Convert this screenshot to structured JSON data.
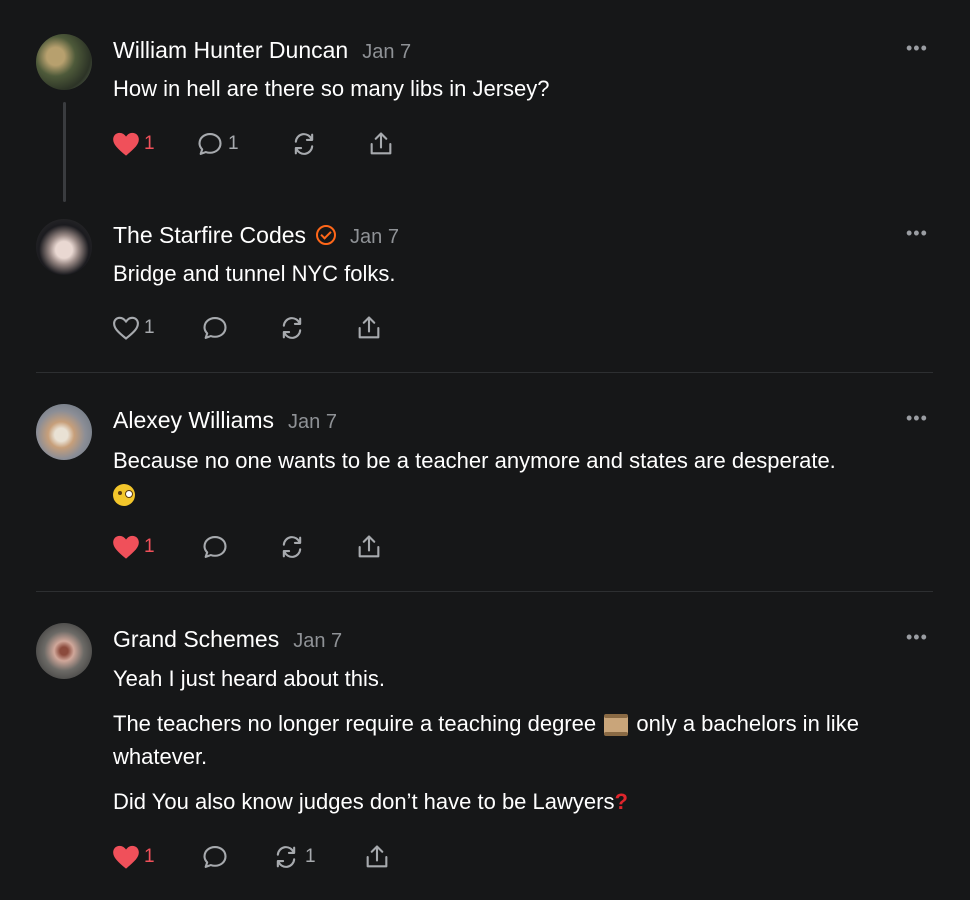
{
  "comments": [
    {
      "author": "William Hunter Duncan",
      "date": "Jan 7",
      "verified": false,
      "text": "How in hell are there so many libs in Jersey?",
      "likes": "1",
      "liked": true,
      "replies": "1",
      "restacks": "",
      "more": "•••"
    },
    {
      "author": "The Starfire Codes",
      "date": "Jan 7",
      "verified": true,
      "text": "Bridge and tunnel NYC folks.",
      "likes": "1",
      "liked": false,
      "replies": "",
      "restacks": "",
      "more": "•••"
    },
    {
      "author": "Alexey Williams",
      "date": "Jan 7",
      "verified": false,
      "text": "Because no one wants to be a teacher anymore and states are desperate.",
      "emoji": "monocle-face-emoji",
      "likes": "1",
      "liked": true,
      "replies": "",
      "restacks": "",
      "more": "•••"
    },
    {
      "author": "Grand Schemes",
      "date": "Jan 7",
      "verified": false,
      "paragraphs": [
        "Yeah I just heard about this.",
        "The teachers no longer require a teaching degree",
        "only a bachelors in like whatever.",
        "Did You also know judges don’t have to be Lawyers"
      ],
      "likes": "1",
      "liked": true,
      "replies": "",
      "restacks": "1",
      "more": "•••"
    }
  ],
  "icons": {
    "like": "heart-icon",
    "reply": "comment-bubble-icon",
    "restack": "restack-icon",
    "share": "share-icon",
    "more": "ellipsis-icon"
  },
  "colors": {
    "background": "#161718",
    "liked": "#f0505a",
    "accent": "#ff6719",
    "muted": "#8f9296"
  }
}
